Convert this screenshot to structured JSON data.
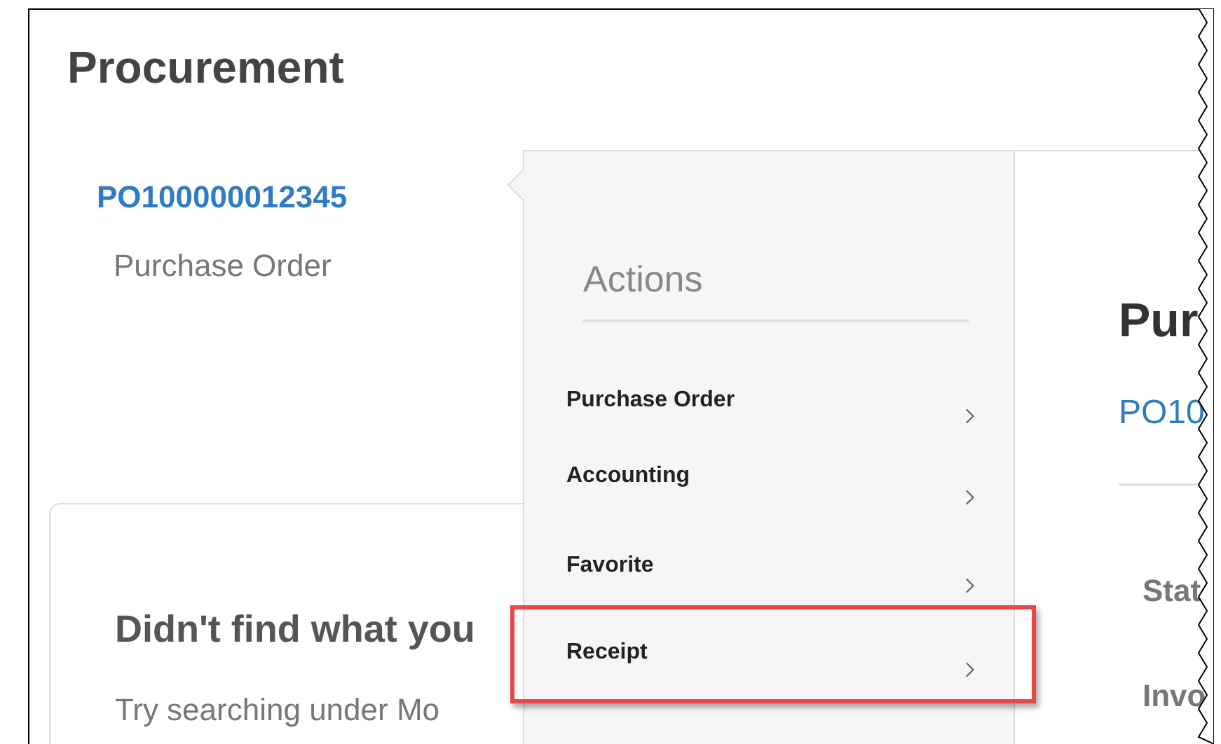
{
  "page": {
    "title": "Procurement"
  },
  "record": {
    "number": "PO100000012345",
    "type": "Purchase Order"
  },
  "help_card": {
    "title": "Didn't find what you",
    "text": "Try searching under Mo"
  },
  "actions_menu": {
    "title": "Actions",
    "items": [
      {
        "label": "Purchase Order",
        "highlighted": false
      },
      {
        "label": "Accounting",
        "highlighted": false
      },
      {
        "label": "Favorite",
        "highlighted": false
      },
      {
        "label": "Receipt",
        "highlighted": true
      }
    ]
  },
  "detail_panel": {
    "title": "Pur",
    "number": "PO10",
    "fields": [
      "Stat",
      "Invo"
    ]
  }
}
